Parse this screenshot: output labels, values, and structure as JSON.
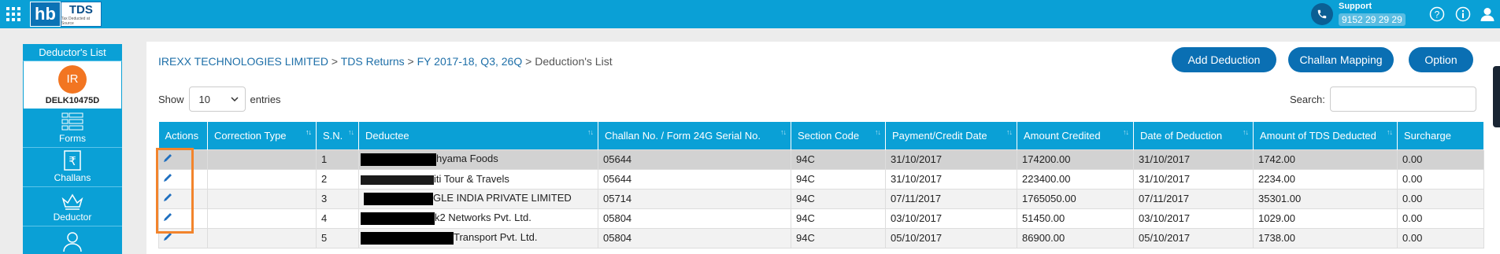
{
  "topbar": {
    "logo_hb": "hb",
    "logo_tds": "TDS",
    "logo_tagline": "Tax Deducted at Source",
    "support_title": "Support",
    "support_number": "9152 29 29 29"
  },
  "sidebar": {
    "header": "Deductor's List",
    "avatar_initials": "IR",
    "deductor_code": "DELK10475D",
    "items": [
      {
        "label": "Forms",
        "icon": "forms-icon"
      },
      {
        "label": "Challans",
        "icon": "challans-icon"
      },
      {
        "label": "Deductor",
        "icon": "deductor-icon"
      }
    ]
  },
  "breadcrumb": {
    "company": "IREXX TECHNOLOGIES LIMITED",
    "returns": "TDS Returns",
    "period": "FY 2017-18, Q3, 26Q",
    "current": "Deduction's List",
    "separator": ">"
  },
  "actions": {
    "add_deduction": "Add Deduction",
    "challan_mapping": "Challan Mapping",
    "option": "Option"
  },
  "controls": {
    "show_label": "Show",
    "entries_value": "10",
    "entries_label": "entries",
    "search_label": "Search:"
  },
  "table": {
    "columns": [
      "Actions",
      "Correction Type",
      "S.N.",
      "Deductee",
      "Challan No. / Form 24G Serial No.",
      "Section Code",
      "Payment/Credit Date",
      "Amount Credited",
      "Date of Deduction",
      "Amount of TDS Deducted",
      "Surcharge"
    ],
    "rows": [
      {
        "sn": "1",
        "deductee": "hyama Foods",
        "challan": "05644",
        "section": "94C",
        "pay_date": "31/10/2017",
        "amount": "174200.00",
        "ded_date": "31/10/2017",
        "tds": "1742.00",
        "surcharge": "0.00"
      },
      {
        "sn": "2",
        "deductee": "iti Tour & Travels",
        "challan": "05644",
        "section": "94C",
        "pay_date": "31/10/2017",
        "amount": "223400.00",
        "ded_date": "31/10/2017",
        "tds": "2234.00",
        "surcharge": "0.00"
      },
      {
        "sn": "3",
        "deductee": "GLE INDIA PRIVATE LIMITED",
        "challan": "05714",
        "section": "94C",
        "pay_date": "07/11/2017",
        "amount": "1765050.00",
        "ded_date": "07/11/2017",
        "tds": "35301.00",
        "surcharge": "0.00"
      },
      {
        "sn": "4",
        "deductee": "k2 Networks Pvt. Ltd.",
        "challan": "05804",
        "section": "94C",
        "pay_date": "03/10/2017",
        "amount": "51450.00",
        "ded_date": "03/10/2017",
        "tds": "1029.00",
        "surcharge": "0.00"
      },
      {
        "sn": "5",
        "deductee": "Transport Pvt. Ltd.",
        "challan": "05804",
        "section": "94C",
        "pay_date": "05/10/2017",
        "amount": "86900.00",
        "ded_date": "05/10/2017",
        "tds": "1738.00",
        "surcharge": "0.00"
      }
    ]
  },
  "colors": {
    "primary": "#0aa0d6",
    "button": "#0a6fb3",
    "avatar": "#f27521",
    "highlight": "#f2842c"
  }
}
